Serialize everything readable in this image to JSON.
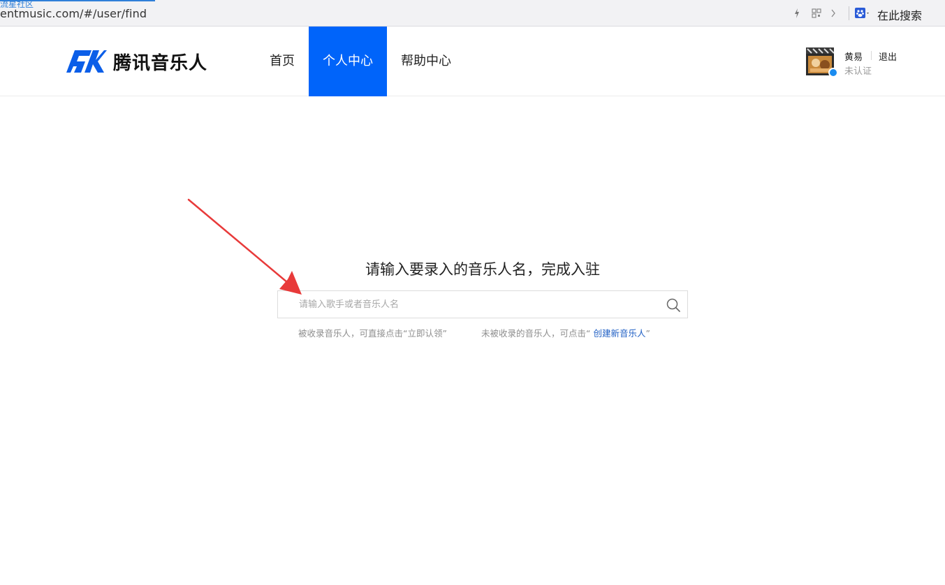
{
  "browser": {
    "tab_label": "流星社区",
    "url": "entmusic.com/#/user/find",
    "search_engine_label": "在此搜索"
  },
  "header": {
    "logo_text": "腾讯音乐人",
    "nav": [
      {
        "label": "首页",
        "active": false
      },
      {
        "label": "个人中心",
        "active": true
      },
      {
        "label": "帮助中心",
        "active": false
      }
    ],
    "user": {
      "name": "黄易",
      "logout_label": "退出",
      "status": "未认证"
    }
  },
  "main": {
    "title": "请输入要录入的音乐人名，完成入驻",
    "search": {
      "placeholder": "请输入歌手或者音乐人名",
      "value": ""
    },
    "hint_left": "被收录音乐人，可直接点击“立即认领”",
    "hint_right_prefix": "未被收录的音乐人，可点击“ ",
    "hint_right_link": "创建新音乐人",
    "hint_right_suffix": "”"
  },
  "colors": {
    "brand_blue": "#0064fa",
    "link_blue": "#1f5fc4",
    "annotation_red": "#e83a3a"
  },
  "icons": [
    "bolt-icon",
    "qr-code-icon",
    "chevron-right-icon",
    "baidu-paw-icon",
    "search-icon",
    "arrow-annotation"
  ]
}
